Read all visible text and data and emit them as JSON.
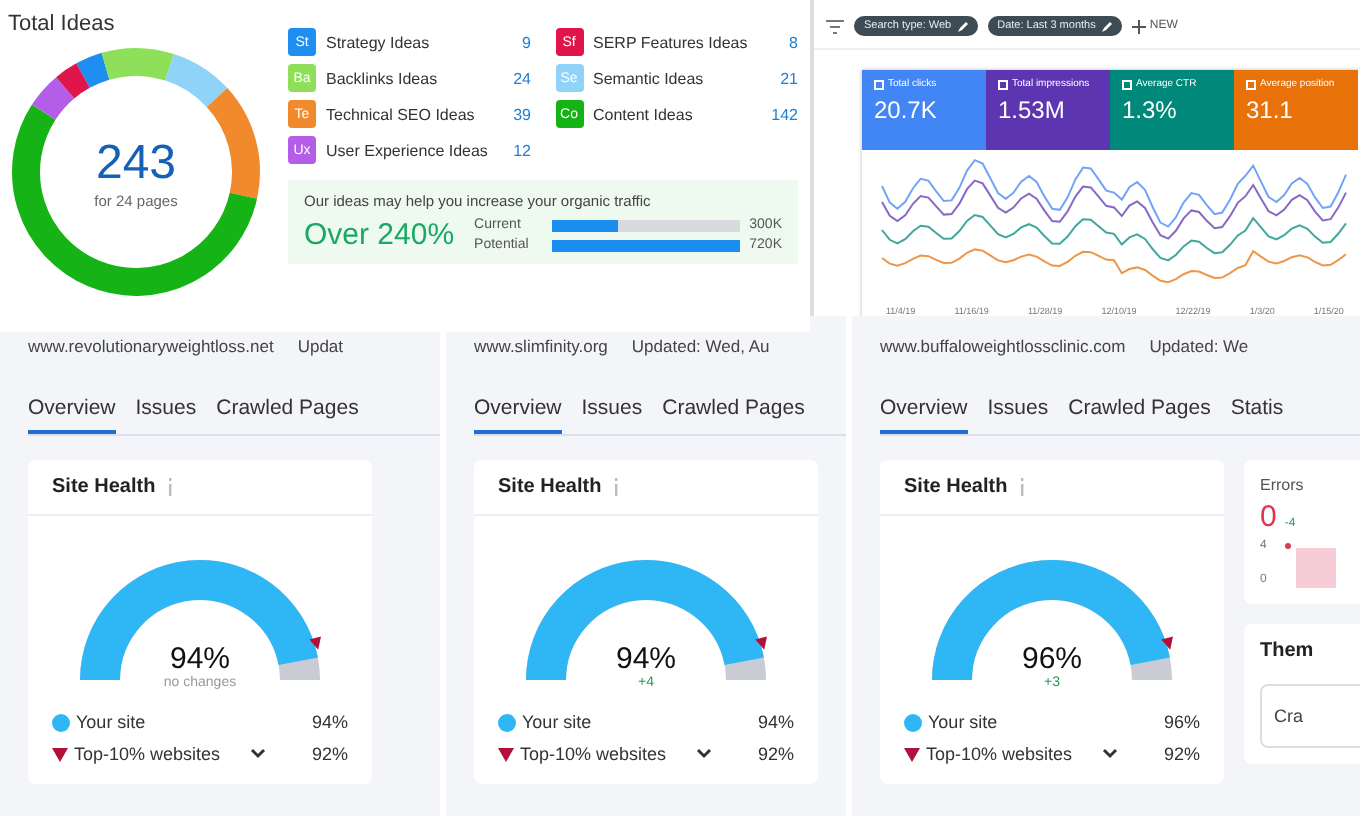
{
  "ideas_panel": {
    "title": "Total Ideas",
    "total": "243",
    "total_caption": "for 24 pages",
    "ideas": [
      {
        "abbr": "St",
        "label": "Strategy Ideas",
        "count": "9",
        "color": "#1e8ff0"
      },
      {
        "abbr": "Sf",
        "label": "SERP Features Ideas",
        "count": "8",
        "color": "#e0154a"
      },
      {
        "abbr": "Ba",
        "label": "Backlinks Ideas",
        "count": "24",
        "color": "#8ee05a"
      },
      {
        "abbr": "Se",
        "label": "Semantic Ideas",
        "count": "21",
        "color": "#8fd3f8"
      },
      {
        "abbr": "Te",
        "label": "Technical SEO Ideas",
        "count": "39",
        "color": "#f08a2c"
      },
      {
        "abbr": "Co",
        "label": "Content Ideas",
        "count": "142",
        "color": "#16b316"
      },
      {
        "abbr": "Ux",
        "label": "User Experience Ideas",
        "count": "12",
        "color": "#b35de8"
      }
    ],
    "traffic": {
      "text": "Our ideas may help you increase your organic traffic",
      "headline": "Over 240%",
      "bars": [
        {
          "label": "Current",
          "level": 0.35,
          "value": "300K"
        },
        {
          "label": "Potential",
          "level": 1,
          "value": "720K"
        }
      ]
    }
  },
  "performance_panel": {
    "filters": [
      {
        "label": "Search type: Web"
      },
      {
        "label": "Date: Last 3 months"
      }
    ],
    "new_button": "NEW",
    "metrics": [
      {
        "label": "Total clicks",
        "value": "20.7K",
        "color": "#4285f4"
      },
      {
        "label": "Total impressions",
        "value": "1.53M",
        "color": "#5e35b1"
      },
      {
        "label": "Average CTR",
        "value": "1.3%",
        "color": "#00897b"
      },
      {
        "label": "Average position",
        "value": "31.1",
        "color": "#e8710a"
      }
    ],
    "x_labels": [
      "11/4/19",
      "11/16/19",
      "11/28/19",
      "12/10/19",
      "12/22/19",
      "1/3/20",
      "1/15/20"
    ]
  },
  "audits": [
    {
      "domain": "www.revolutionaryweightloss.net",
      "updated": "Updat",
      "tabs": [
        {
          "label": "Overview",
          "selected": true
        },
        {
          "label": "Issues",
          "selected": false
        },
        {
          "label": "Crawled Pages",
          "selected": false
        }
      ],
      "health": {
        "title": "Site Health",
        "score": "94%",
        "change": {
          "kind": "none",
          "text": "no changes"
        },
        "legend": [
          {
            "kind": "dot",
            "label": "Your site",
            "value": "94%"
          },
          {
            "kind": "triangle",
            "label": "Top-10% websites",
            "value": "92%"
          }
        ]
      }
    },
    {
      "domain": "www.slimfinity.org",
      "updated": "Updated: Wed, Au",
      "tabs": [
        {
          "label": "Overview",
          "selected": true
        },
        {
          "label": "Issues",
          "selected": false
        },
        {
          "label": "Crawled Pages",
          "selected": false
        }
      ],
      "health": {
        "title": "Site Health",
        "score": "94%",
        "change": {
          "kind": "up",
          "text": "+4"
        },
        "legend": [
          {
            "kind": "dot",
            "label": "Your site",
            "value": "94%"
          },
          {
            "kind": "triangle",
            "label": "Top-10% websites",
            "value": "92%"
          }
        ]
      }
    },
    {
      "domain": "www.buffaloweightlossclinic.com",
      "updated": "Updated: We",
      "tabs": [
        {
          "label": "Overview",
          "selected": true
        },
        {
          "label": "Issues",
          "selected": false
        },
        {
          "label": "Crawled Pages",
          "selected": false
        },
        {
          "label": "Statis",
          "selected": false
        }
      ],
      "health": {
        "title": "Site Health",
        "score": "96%",
        "change": {
          "kind": "up",
          "text": "+3"
        },
        "legend": [
          {
            "kind": "dot",
            "label": "Your site",
            "value": "96%"
          },
          {
            "kind": "triangle",
            "label": "Top-10% websites",
            "value": "92%"
          }
        ]
      },
      "errors": {
        "title": "Errors",
        "value": "0",
        "change": "-4",
        "ticks": [
          "4",
          "0"
        ]
      },
      "themes": {
        "title": "Them",
        "button": "Cra"
      }
    }
  ]
}
